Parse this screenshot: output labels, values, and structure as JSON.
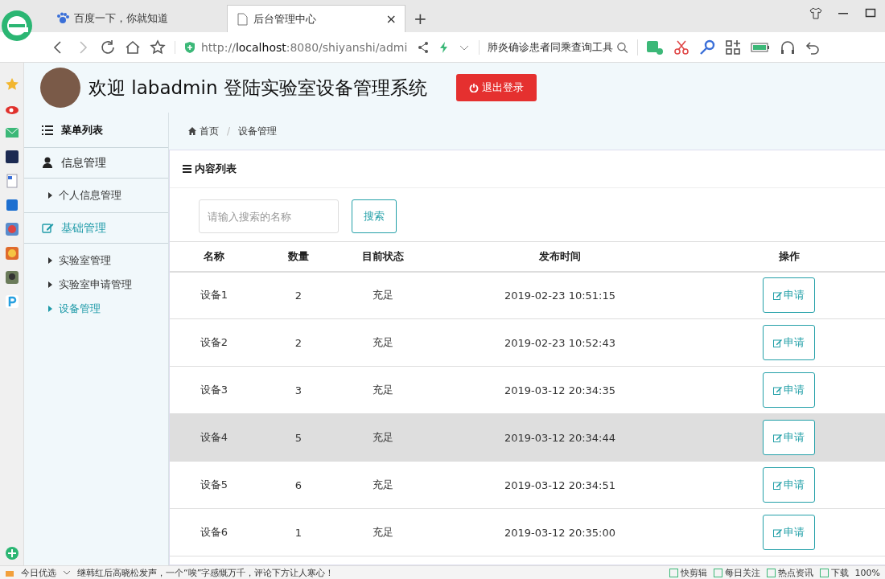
{
  "browser": {
    "tabs": [
      {
        "title": "百度一下，你就知道",
        "selected": false
      },
      {
        "title": "后台管理中心",
        "selected": true,
        "close": "×"
      }
    ],
    "new_tab": "+",
    "url": {
      "scheme": "http://",
      "host": "localhost",
      "rest": ":8080/shiyanshi/admi"
    },
    "search": {
      "value": "肺炎确诊患者同乘查询工具"
    }
  },
  "header": {
    "title": "欢迎 labadmin 登陆实验室设备管理系统",
    "logout": "退出登录"
  },
  "sidebar": {
    "title": "菜单列表",
    "groups": [
      {
        "label": "信息管理",
        "active": false,
        "items": [
          {
            "label": "个人信息管理",
            "selected": false
          }
        ]
      },
      {
        "label": "基础管理",
        "active": true,
        "items": [
          {
            "label": "实验室管理",
            "selected": false
          },
          {
            "label": "实验室申请管理",
            "selected": false
          },
          {
            "label": "设备管理",
            "selected": true
          }
        ]
      }
    ]
  },
  "breadcrumb": {
    "separator": "/",
    "items": [
      {
        "label": "首页"
      },
      {
        "label": "设备管理"
      }
    ]
  },
  "panel": {
    "title": "内容列表",
    "search": {
      "placeholder": "请输入搜索的名称",
      "button": "搜索"
    },
    "table": {
      "columns": [
        "名称",
        "数量",
        "目前状态",
        "发布时间",
        "操作"
      ],
      "rows": [
        {
          "name": "设备1",
          "count": "2",
          "status": "充足",
          "time": "2019-02-23 10:51:15",
          "action": "申请",
          "highlighted": false
        },
        {
          "name": "设备2",
          "count": "2",
          "status": "充足",
          "time": "2019-02-23 10:52:43",
          "action": "申请",
          "highlighted": false
        },
        {
          "name": "设备3",
          "count": "3",
          "status": "充足",
          "time": "2019-03-12 20:34:35",
          "action": "申请",
          "highlighted": false
        },
        {
          "name": "设备4",
          "count": "5",
          "status": "充足",
          "time": "2019-03-12 20:34:44",
          "action": "申请",
          "highlighted": true
        },
        {
          "name": "设备5",
          "count": "6",
          "status": "充足",
          "time": "2019-03-12 20:34:51",
          "action": "申请",
          "highlighted": false
        },
        {
          "name": "设备6",
          "count": "1",
          "status": "充足",
          "time": "2019-03-12 20:35:00",
          "action": "申请",
          "highlighted": false
        }
      ]
    }
  },
  "status_bar": {
    "left": "今日优选",
    "news": "继韩红后高晓松发声，一个“唉”字感慨万千，评论下方让人寒心！",
    "items": [
      "快剪辑",
      "每日关注",
      "热点资讯",
      "下载"
    ],
    "zoom": "100%"
  }
}
